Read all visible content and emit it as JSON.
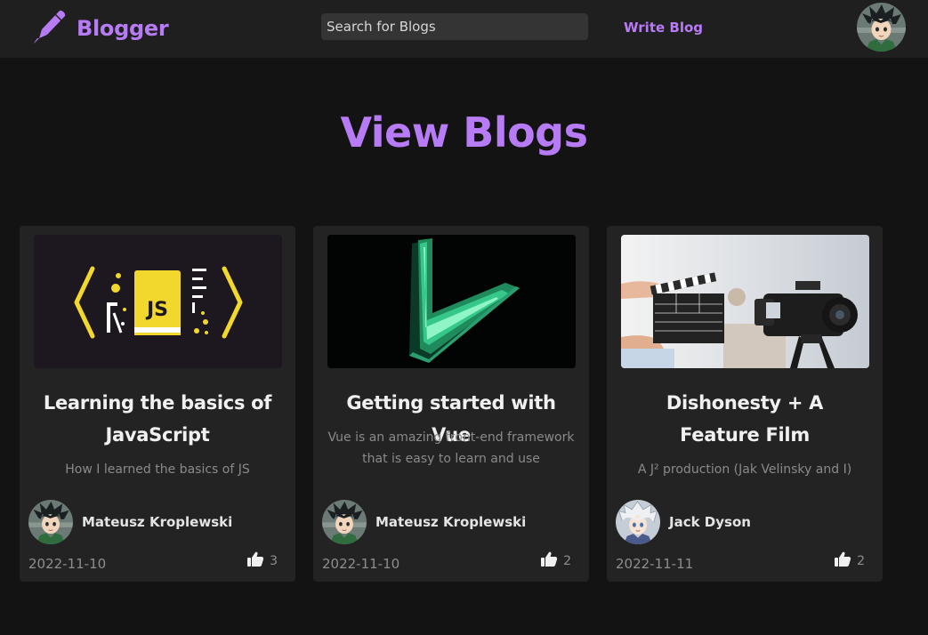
{
  "header": {
    "brand": "Blogger",
    "search_placeholder": "Search for Blogs",
    "write_link": "Write Blog",
    "brand_color": "#b77cf5"
  },
  "page_title": "View Blogs",
  "blogs": [
    {
      "title": "Learning the basics of JavaScript",
      "description": "How I learned the basics of JS",
      "image_icon": "javascript-book-icon",
      "image_label": "JS",
      "author": "Mateusz Kroplewski",
      "avatar_icon": "anime-boy-avatar",
      "date": "2022-11-10",
      "likes": "3"
    },
    {
      "title": "Getting started with Vue",
      "description": "Vue is an amazing front-end framework that is easy to learn and use",
      "image_icon": "vue-logo-icon",
      "author": "Mateusz Kroplewski",
      "avatar_icon": "anime-boy-avatar",
      "date": "2022-11-10",
      "likes": "2"
    },
    {
      "title": "Dishonesty + A Feature Film",
      "description": "A J² production (Jak Velinsky and I)",
      "image_icon": "film-clapperboard-camera-photo",
      "author": "Jack Dyson",
      "avatar_icon": "anime-white-hair-avatar",
      "date": "2022-11-11",
      "likes": "2"
    }
  ]
}
